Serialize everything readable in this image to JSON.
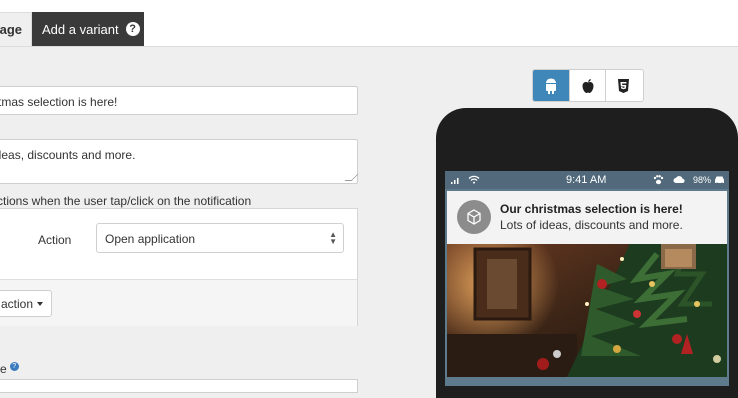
{
  "tabs": {
    "active_label": "age",
    "variant_label": "Add a variant",
    "variant_help": "?"
  },
  "form": {
    "title_value": "stmas selection is here!",
    "message_value": "ideas, discounts and more.",
    "actions_caption": "ctions when the user tap/click on the notification",
    "action_label": "Action",
    "action_select_value": "Open application",
    "add_action_label": "action",
    "bottom_label": "e"
  },
  "preview": {
    "platforms": [
      "android-icon",
      "apple-icon",
      "html5-icon"
    ],
    "status_time": "9:41 AM",
    "battery": "98%",
    "notification_title": "Our christmas selection is here!",
    "notification_body": "Lots of ideas, discounts and more."
  },
  "colors": {
    "accent": "#3f87b8",
    "dark_tab": "#3a3a3a",
    "phone_body": "#1e1e1e",
    "statusbar": "#51697a"
  }
}
